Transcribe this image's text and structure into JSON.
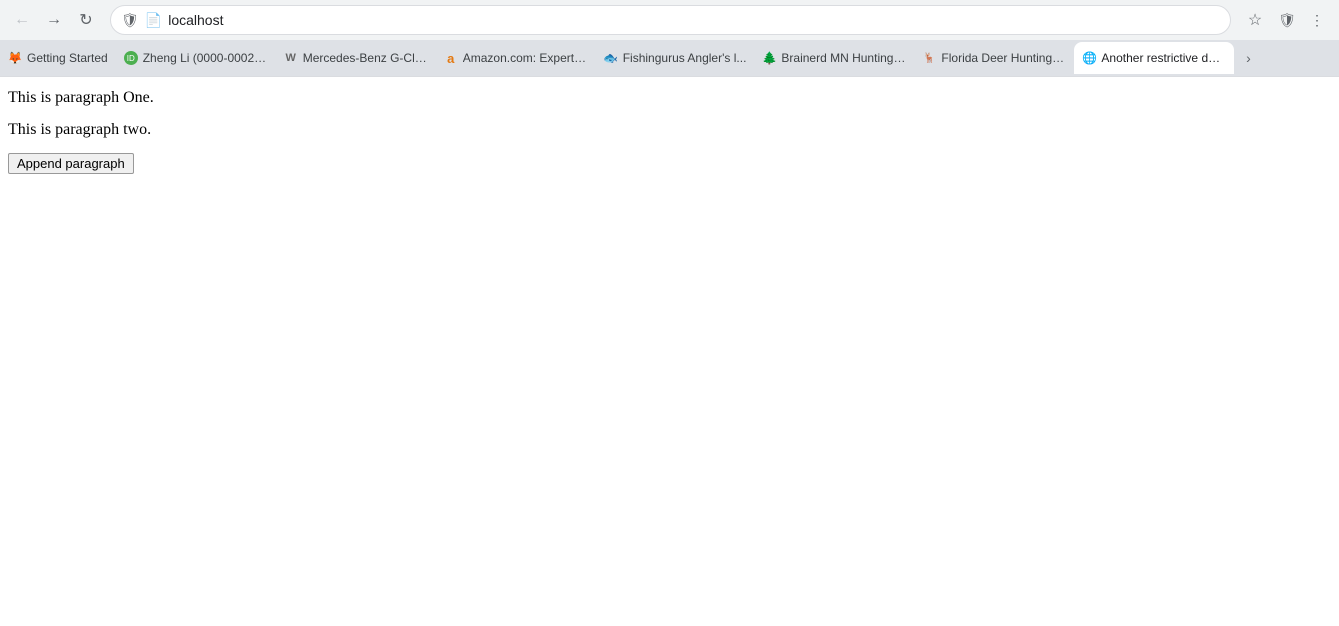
{
  "browser": {
    "address": "localhost",
    "nav": {
      "back_label": "←",
      "forward_label": "→",
      "refresh_label": "↻"
    },
    "tabs": [
      {
        "id": "getting-started",
        "label": "Getting Started",
        "favicon": "🦊",
        "favicon_type": "fire",
        "active": false
      },
      {
        "id": "zheng-li",
        "label": "Zheng Li (0000-0002-3...",
        "favicon": "ID",
        "favicon_type": "id",
        "active": false
      },
      {
        "id": "mercedes",
        "label": "Mercedes-Benz G-Clas...",
        "favicon": "W",
        "favicon_type": "w",
        "active": false
      },
      {
        "id": "amazon",
        "label": "Amazon.com: ExpertP...",
        "favicon": "a",
        "favicon_type": "a",
        "active": false
      },
      {
        "id": "fishingurus",
        "label": "Fishingurus Angler's l...",
        "favicon": "🐟",
        "favicon_type": "fish",
        "active": false
      },
      {
        "id": "brainerd",
        "label": "Brainerd MN Hunting ...",
        "favicon": "🌲",
        "favicon_type": "tree",
        "active": false
      },
      {
        "id": "florida-deer",
        "label": "Florida Deer Hunting S...",
        "favicon": "🦌",
        "favicon_type": "deer",
        "active": false
      },
      {
        "id": "another",
        "label": "Another restrictive dee...",
        "favicon": "🌐",
        "favicon_type": "globe",
        "active": true
      }
    ],
    "more_tabs_label": "›"
  },
  "page": {
    "paragraph1": "This is paragraph One.",
    "paragraph2": "This is paragraph two.",
    "button_label": "Append paragraph"
  }
}
